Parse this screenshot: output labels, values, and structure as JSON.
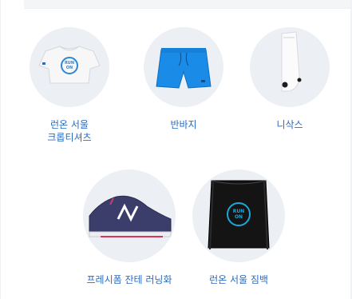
{
  "items": [
    {
      "label": "런온 서울\n크롭티셔츠",
      "icon": "crop-tee-icon"
    },
    {
      "label": "반바지",
      "icon": "shorts-icon"
    },
    {
      "label": "니삭스",
      "icon": "knee-socks-icon"
    },
    {
      "label": "프레시폼 잔테 러닝화",
      "icon": "running-shoe-icon"
    },
    {
      "label": "런온 서울 짐백",
      "icon": "gym-bag-icon"
    }
  ],
  "colors": {
    "label": "#2a6cc1",
    "circle": "#eceff4",
    "shorts": "#1a8be6"
  }
}
